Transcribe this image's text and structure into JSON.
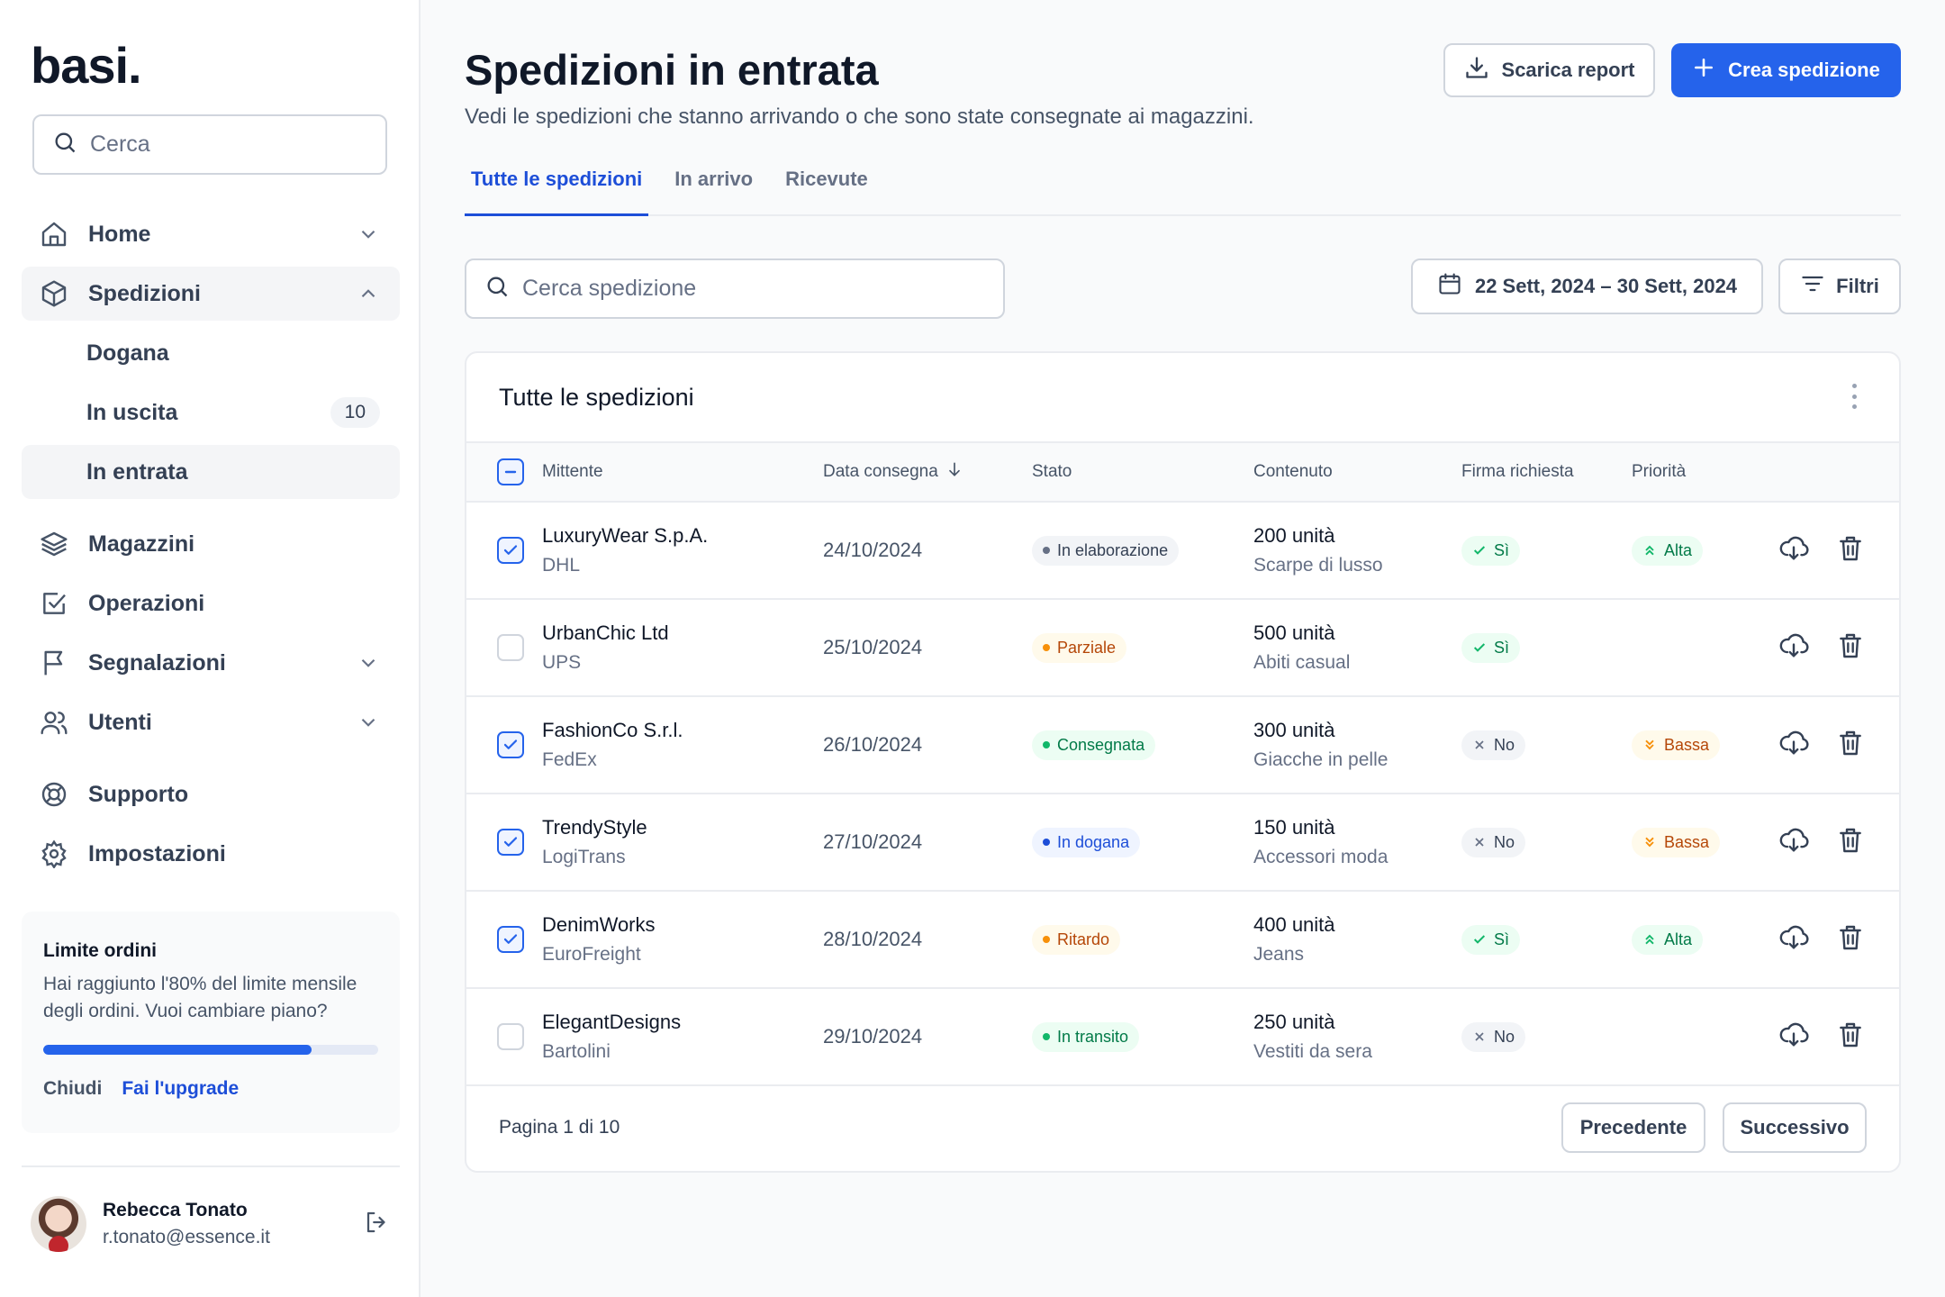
{
  "sidebar": {
    "logo": "basi.",
    "search_placeholder": "Cerca",
    "nav": {
      "home": "Home",
      "spedizioni": "Spedizioni",
      "sub_dogana": "Dogana",
      "sub_uscita": "In uscita",
      "sub_uscita_count": "10",
      "sub_entrata": "In entrata",
      "magazzini": "Magazzini",
      "operazioni": "Operazioni",
      "segnalazioni": "Segnalazioni",
      "utenti": "Utenti",
      "supporto": "Supporto",
      "impostazioni": "Impostazioni"
    },
    "limit_card": {
      "title": "Limite ordini",
      "text": "Hai raggiunto l'80% del limite mensile degli ordini. Vuoi cambiare piano?",
      "progress": 0.8,
      "close": "Chiudi",
      "upgrade": "Fai l'upgrade"
    },
    "user": {
      "name": "Rebecca Tonato",
      "email": "r.tonato@essence.it"
    }
  },
  "header": {
    "title": "Spedizioni in entrata",
    "subtitle": "Vedi le spedizioni che stanno arrivando o che sono state consegnate ai magazzini.",
    "report_btn": "Scarica report",
    "create_btn": "Crea spedizione"
  },
  "tabs": [
    "Tutte le spedizioni",
    "In arrivo",
    "Ricevute"
  ],
  "toolbar": {
    "search_placeholder": "Cerca spedizione",
    "date_range": "22 Sett, 2024 – 30 Sett, 2024",
    "filters": "Filtri"
  },
  "table": {
    "title": "Tutte le spedizioni",
    "columns": {
      "mittente": "Mittente",
      "data": "Data consegna",
      "stato": "Stato",
      "contenuto": "Contenuto",
      "firma": "Firma richiesta",
      "priorita": "Priorità"
    },
    "rows": [
      {
        "checked": true,
        "sender": "LuxuryWear S.p.A.",
        "carrier": "DHL",
        "date": "24/10/2024",
        "status": "In elaborazione",
        "status_kind": "gray",
        "qty": "200 unità",
        "desc": "Scarpe di lusso",
        "signature": "Sì",
        "sig_kind": "yes",
        "priority": "Alta",
        "prio_kind": "high"
      },
      {
        "checked": false,
        "sender": "UrbanChic Ltd",
        "carrier": "UPS",
        "date": "25/10/2024",
        "status": "Parziale",
        "status_kind": "orange",
        "qty": "500 unità",
        "desc": "Abiti casual",
        "signature": "Sì",
        "sig_kind": "yes",
        "priority": "",
        "prio_kind": ""
      },
      {
        "checked": true,
        "sender": "FashionCo S.r.l.",
        "carrier": "FedEx",
        "date": "26/10/2024",
        "status": "Consegnata",
        "status_kind": "green",
        "qty": "300 unità",
        "desc": "Giacche in pelle",
        "signature": "No",
        "sig_kind": "no",
        "priority": "Bassa",
        "prio_kind": "low"
      },
      {
        "checked": true,
        "sender": "TrendyStyle",
        "carrier": "LogiTrans",
        "date": "27/10/2024",
        "status": "In dogana",
        "status_kind": "blue",
        "qty": "150 unità",
        "desc": "Accessori moda",
        "signature": "No",
        "sig_kind": "no",
        "priority": "Bassa",
        "prio_kind": "low"
      },
      {
        "checked": true,
        "sender": "DenimWorks",
        "carrier": "EuroFreight",
        "date": "28/10/2024",
        "status": "Ritardo",
        "status_kind": "orange",
        "qty": "400 unità",
        "desc": "Jeans",
        "signature": "Sì",
        "sig_kind": "yes",
        "priority": "Alta",
        "prio_kind": "high"
      },
      {
        "checked": false,
        "sender": "ElegantDesigns",
        "carrier": "Bartolini",
        "date": "29/10/2024",
        "status": "In transito",
        "status_kind": "green",
        "qty": "250 unità",
        "desc": "Vestiti da sera",
        "signature": "No",
        "sig_kind": "no",
        "priority": "",
        "prio_kind": ""
      }
    ],
    "pagination": {
      "label": "Pagina 1 di 10",
      "prev": "Precedente",
      "next": "Successivo"
    }
  },
  "colors": {
    "accent": "#2563eb",
    "green": "#12b76a",
    "orange": "#f79009",
    "gray": "#667085",
    "blue": "#1d4ed8"
  }
}
